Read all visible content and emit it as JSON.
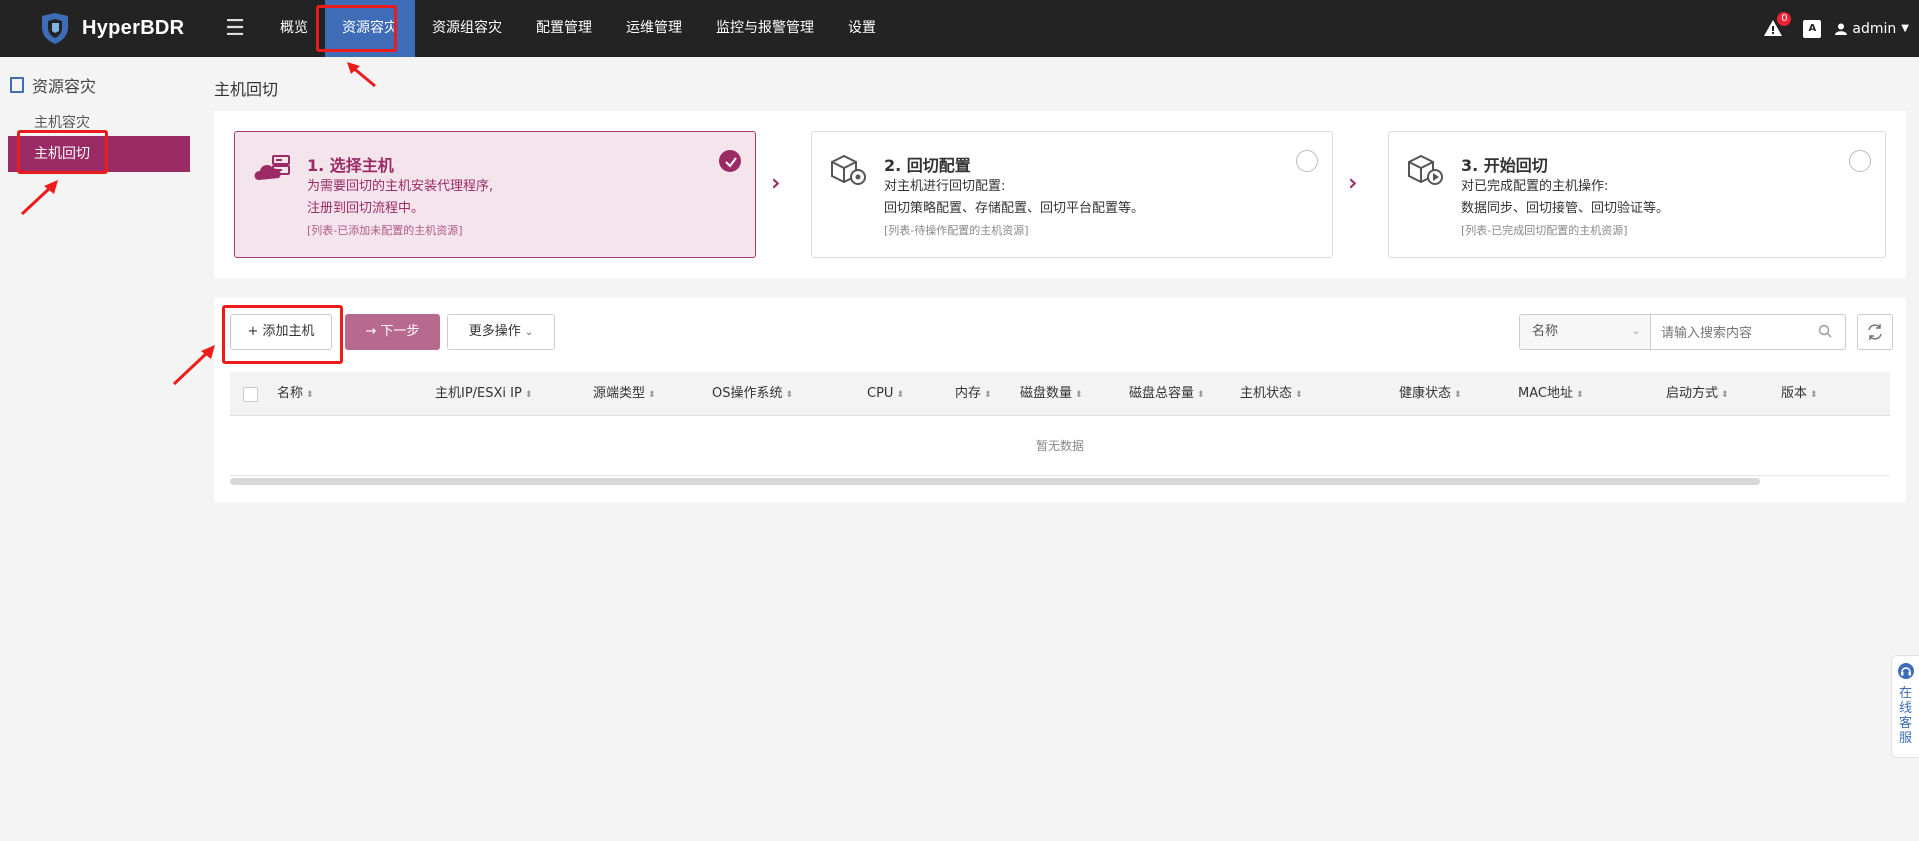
{
  "app": {
    "brand": "HyperBDR"
  },
  "nav": {
    "items": [
      {
        "label": "概览"
      },
      {
        "label": "资源容灾"
      },
      {
        "label": "资源组容灾"
      },
      {
        "label": "配置管理"
      },
      {
        "label": "运维管理"
      },
      {
        "label": "监控与报警管理"
      },
      {
        "label": "设置"
      }
    ],
    "active_index": 1,
    "alert_count": "0",
    "font_icon": "A",
    "user": "admin"
  },
  "sidebar": {
    "section": "资源容灾",
    "items": [
      {
        "label": "主机容灾"
      },
      {
        "label": "主机回切"
      }
    ],
    "active_index": 1
  },
  "page": {
    "title": "主机回切"
  },
  "steps": [
    {
      "title": "1. 选择主机",
      "desc_1": "为需要回切的主机安装代理程序,",
      "desc_2": "注册到回切流程中。",
      "hint": "[列表-已添加未配置的主机资源]",
      "done": true
    },
    {
      "title": "2. 回切配置",
      "desc_1": "对主机进行回切配置:",
      "desc_2": "回切策略配置、存储配置、回切平台配置等。",
      "hint": "[列表-待操作配置的主机资源]",
      "done": false
    },
    {
      "title": "3. 开始回切",
      "desc_1": "对已完成配置的主机操作:",
      "desc_2": "数据同步、回切接管、回切验证等。",
      "hint": "[列表-已完成回切配置的主机资源]",
      "done": false
    }
  ],
  "toolbar": {
    "add_label": "添加主机",
    "next_label": "下一步",
    "more_label": "更多操作",
    "search_field": "名称",
    "search_placeholder": "请输入搜索内容"
  },
  "table": {
    "columns": [
      "名称",
      "主机IP/ESXi IP",
      "源端类型",
      "OS操作系统",
      "CPU",
      "内存",
      "磁盘数量",
      "磁盘总容量",
      "主机状态",
      "健康状态",
      "MAC地址",
      "启动方式",
      "版本"
    ],
    "empty_text": "暂无数据"
  },
  "float": {
    "label": "在线客服"
  },
  "colors": {
    "accent": "#9b2b64",
    "nav_active": "#3e6cb7",
    "topbar": "#232323",
    "annotation": "#ee1b1b"
  }
}
